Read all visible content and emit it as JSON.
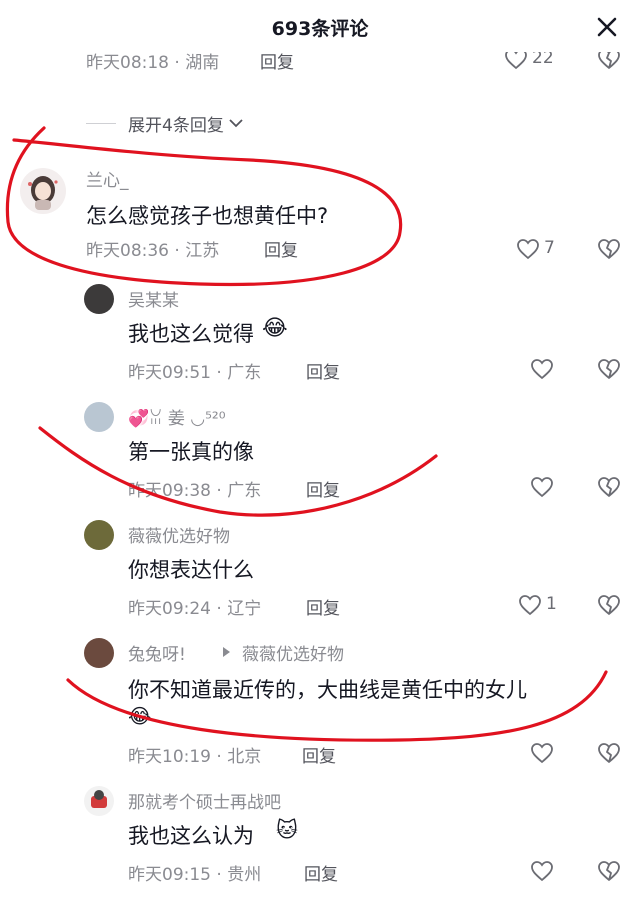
{
  "header": {
    "title": "693条评论"
  },
  "previous": {
    "meta": "昨天08:18 · 湖南",
    "reply": "回复",
    "likes": "22"
  },
  "expand": {
    "label": "展开4条回复"
  },
  "comments": [
    {
      "user": "兰心_",
      "text": "怎么感觉孩子也想黄任中?",
      "meta": "昨天08:36 · 江苏",
      "reply": "回复",
      "likes": "7"
    },
    {
      "user": "吴某某",
      "text": "我也这么觉得",
      "meta": "昨天09:51 · 广东",
      "reply": "回复",
      "likes": ""
    },
    {
      "user": "💞ꈍ 姜 ◡⁵²⁰",
      "text": "第一张真的像",
      "meta": "昨天09:38 · 广东",
      "reply": "回复",
      "likes": ""
    },
    {
      "user": "薇薇优选好物",
      "text": "你想表达什么",
      "meta": "昨天09:24 · 辽宁",
      "reply": "回复",
      "likes": "1"
    },
    {
      "user": "兔兔呀!",
      "reply_to": "薇薇优选好物",
      "text": "你不知道最近传的，大曲线是黄任中的女儿",
      "meta": "昨天10:19 · 北京",
      "reply": "回复",
      "likes": ""
    },
    {
      "user": "那就考个硕士再战吧",
      "text": "我也这么认为",
      "meta": "昨天09:15 · 贵州",
      "reply": "回复",
      "likes": ""
    }
  ],
  "colors": {
    "annotation": "#e0121f",
    "text": "#161823",
    "meta": "#8a8b91"
  }
}
